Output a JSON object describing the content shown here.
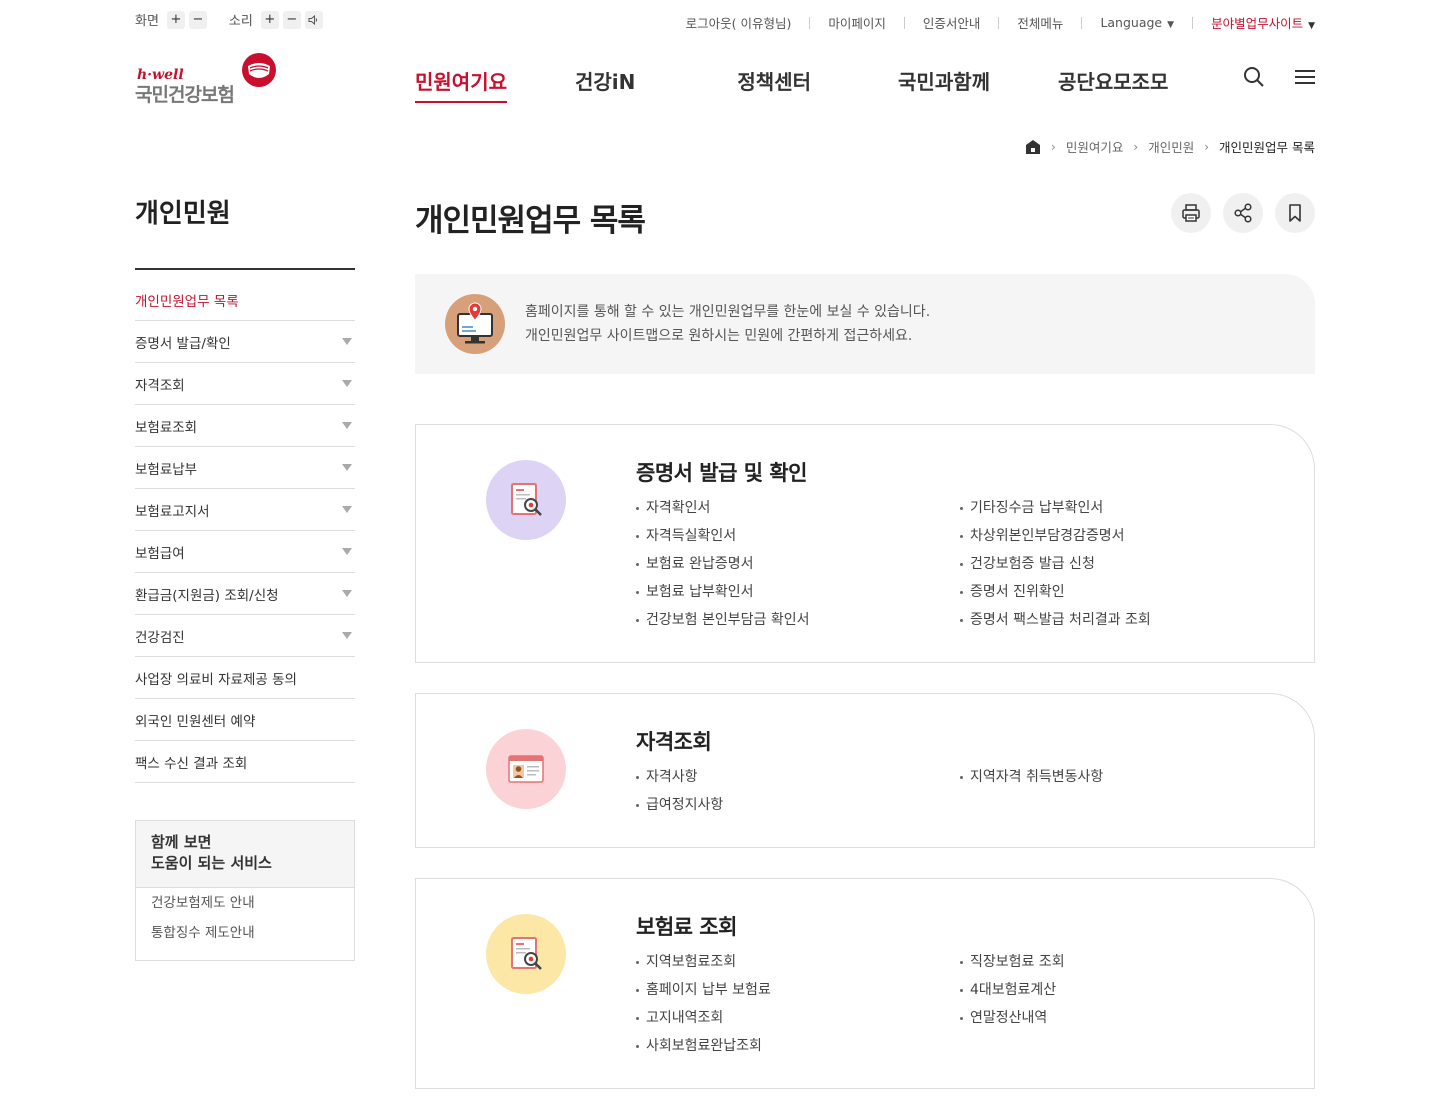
{
  "util": {
    "screen_label": "화면",
    "sound_label": "소리",
    "plus": "+",
    "minus": "−",
    "links": [
      {
        "label": "로그아웃( 이유형님)"
      },
      {
        "label": "마이페이지"
      },
      {
        "label": "인증서안내"
      },
      {
        "label": "전체메뉴"
      },
      {
        "label": "Language"
      },
      {
        "label": "분야별업무사이트"
      }
    ]
  },
  "logo": {
    "brand": "h·well",
    "name": "국민건강보험"
  },
  "gnb": [
    "민원여기요",
    "건강iN",
    "정책센터",
    "국민과함께",
    "공단요모조모"
  ],
  "breadcrumb": [
    "민원여기요",
    "개인민원",
    "개인민원업무 목록"
  ],
  "sidebar": {
    "title": "개인민원",
    "items": [
      {
        "label": "개인민원업무 목록"
      },
      {
        "label": "증명서 발급/확인"
      },
      {
        "label": "자격조회"
      },
      {
        "label": "보험료조회"
      },
      {
        "label": "보험료납부"
      },
      {
        "label": "보험료고지서"
      },
      {
        "label": "보험급여"
      },
      {
        "label": "환급금(지원금) 조회/신청"
      },
      {
        "label": "건강검진"
      },
      {
        "label": "사업장 의료비 자료제공 동의"
      },
      {
        "label": "외국인 민원센터 예약"
      },
      {
        "label": "팩스 수신 결과 조회"
      }
    ],
    "help": {
      "title_line1": "함께 보면",
      "title_line2": "도움이 되는 서비스",
      "links": [
        "건강보험제도 안내",
        "통합징수 제도안내"
      ]
    }
  },
  "main": {
    "title": "개인민원업무 목록",
    "intro_line1": "홈페이지를 통해 할 수 있는 개인민원업무를 한눈에 보실 수 있습니다.",
    "intro_line2": "개인민원업무 사이트맵으로 원하시는 민원에 간편하게 접근하세요.",
    "cards": [
      {
        "title": "증명서 발급 및 확인",
        "color": "#dcd3f5",
        "left": [
          "자격확인서",
          "자격득실확인서",
          "보험료 완납증명서",
          "보험료 납부확인서",
          "건강보험 본인부담금 확인서"
        ],
        "right": [
          "기타징수금 납부확인서",
          "차상위본인부담경감증명서",
          "건강보험증 발급 신청",
          "증명서 진위확인",
          "증명서 팩스발급 처리결과 조회"
        ]
      },
      {
        "title": "자격조회",
        "color": "#fbd3d6",
        "left": [
          "자격사항",
          "급여정지사항"
        ],
        "right": [
          "지역자격 취득변동사항"
        ]
      },
      {
        "title": "보험료 조회",
        "color": "#fde7a6",
        "left": [
          "지역보험료조회",
          "홈페이지 납부 보험료",
          "고지내역조회",
          "사회보험료완납조회"
        ],
        "right": [
          "직장보험료 조회",
          "4대보험료계산",
          "연말정산내역"
        ]
      }
    ]
  },
  "colors": {
    "accent": "#c8102e"
  }
}
